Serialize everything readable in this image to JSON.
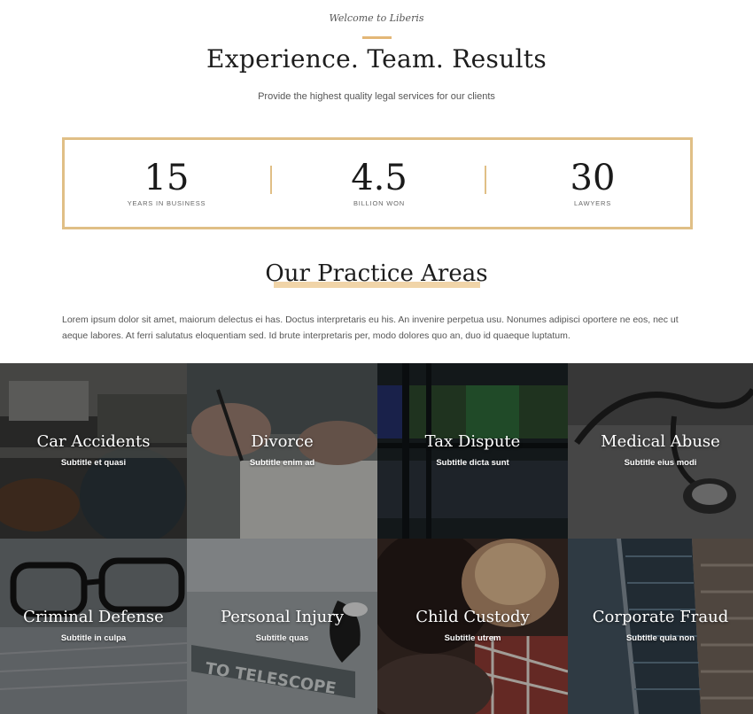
{
  "header": {
    "welcome": "Welcome to Liberis",
    "title": "Experience. Team. Results",
    "subtitle": "Provide the highest quality legal services for our clients"
  },
  "stats": [
    {
      "value": "15",
      "label": "YEARS IN BUSINESS"
    },
    {
      "value": "4.5",
      "label": "BILLION WON"
    },
    {
      "value": "30",
      "label": "LAWYERS"
    }
  ],
  "practice": {
    "title": "Our Practice Areas",
    "intro": "Lorem ipsum dolor sit amet, maiorum delectus ei has. Doctus interpretaris eu his. An invenire perpetua usu. Nonumes adipisci oportere ne eos, nec ut aeque labores. At ferri salutatus eloquentiam sed. Id brute interpretaris per, modo dolores quo an, duo id quaeque luptatum.",
    "areas": [
      {
        "name": "Car Accidents",
        "subtitle": "Subtitle et quasi"
      },
      {
        "name": "Divorce",
        "subtitle": "Subtitle enim ad"
      },
      {
        "name": "Tax Dispute",
        "subtitle": "Subtitle dicta sunt"
      },
      {
        "name": "Medical Abuse",
        "subtitle": "Subtitle eius modi"
      },
      {
        "name": "Criminal Defense",
        "subtitle": "Subtitle in culpa"
      },
      {
        "name": "Personal Injury",
        "subtitle": "Subtitle quas"
      },
      {
        "name": "Child Custody",
        "subtitle": "Subtitle utrem"
      },
      {
        "name": "Corporate Fraud",
        "subtitle": "Subtitle quia non"
      }
    ],
    "sign_text": "TO TELESCOPE"
  },
  "colors": {
    "accent": "#e0bf86",
    "tile_tint": "#2a2a2a"
  }
}
